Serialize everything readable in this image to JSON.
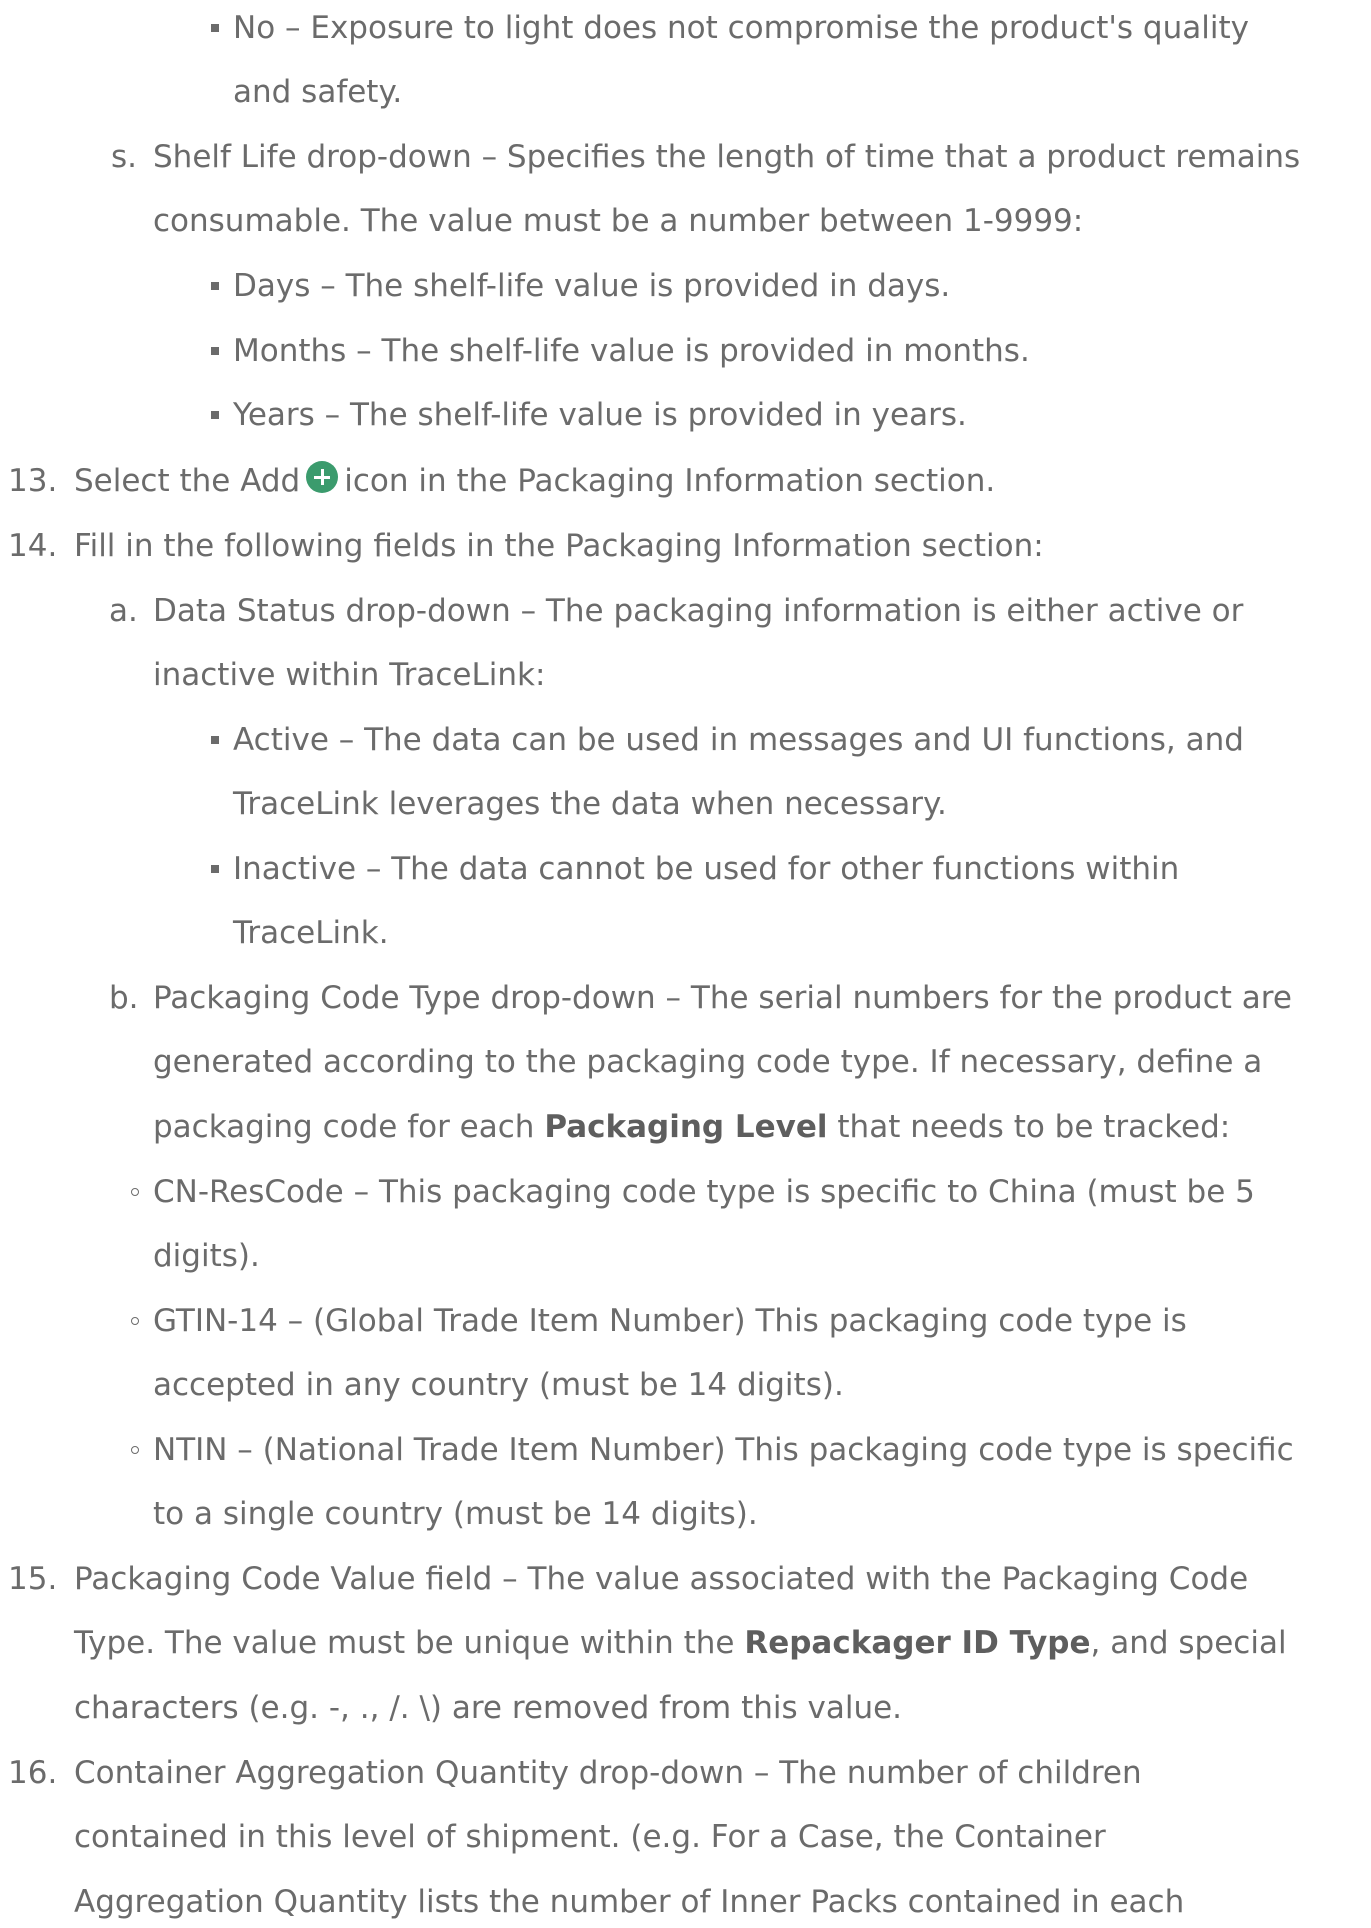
{
  "lines": {
    "r_no_1": "No – Exposure to light does not compromise the product's quality",
    "r_no_2": "and safety.",
    "s_marker": "s.",
    "s_1": "Shelf Life drop-down – Specifies the length of time that a product remains",
    "s_2": "consumable. The value must be a number between 1-9999:",
    "s_days": "Days – The shelf-life value is provided in days.",
    "s_months": "Months – The shelf-life value is provided in months.",
    "s_years": "Years – The shelf-life value is provided in years.",
    "n13_marker": "13.",
    "n13_pre": "Select the Add",
    "n13_post": "icon in the Packaging Information section.",
    "n14_marker": "14.",
    "n14": "Fill in the following fields in the Packaging Information section:",
    "a_marker": "a.",
    "a_1": "Data Status drop-down – The packaging information is either active or",
    "a_2": "inactive within TraceLink:",
    "a_active_1": "Active – The data can be used in messages and UI functions, and",
    "a_active_2": "TraceLink leverages the data when necessary.",
    "a_inactive_1": "Inactive – The data cannot be used for other functions within",
    "a_inactive_2": "TraceLink.",
    "b_marker": "b.",
    "b_1": "Packaging Code Type drop-down – The serial numbers for the product are",
    "b_2": "generated according to the packaging code type. If necessary, define a",
    "b_3_pre": "packaging code for each",
    "b_3_bold": "Packaging Level",
    "b_3_post": "that needs to be tracked:",
    "cn_1": "CN-ResCode – This packaging code type is specific to China (must be 5",
    "cn_2": "digits).",
    "gtin_1": "GTIN-14 – (Global Trade Item Number) This packaging code type is",
    "gtin_2": "accepted in any country (must be 14 digits).",
    "ntin_1": "NTIN – (National Trade Item Number) This packaging code type is specific",
    "ntin_2": "to a single country (must be 14 digits).",
    "n15_marker": "15.",
    "n15_1": "Packaging Code Value field – The value associated with the Packaging Code",
    "n15_2_pre": "Type. The value must be unique within the",
    "n15_2_bold": "Repackager ID Type",
    "n15_2_post": ", and special",
    "n15_3": "characters (e.g. -, ., /. \\) are removed from this value.",
    "n16_marker": "16.",
    "n16_1": "Container Aggregation Quantity drop-down – The number of children",
    "n16_2": "contained in this level of shipment. (e.g. For a Case, the Container",
    "n16_3": "Aggregation Quantity lists the number of Inner Packs contained in each"
  },
  "icons": {
    "add": "plus-circle-icon",
    "add_color": "#3b9b6d"
  },
  "colors": {
    "text": "#6b6b6b",
    "background": "#ffffff"
  }
}
